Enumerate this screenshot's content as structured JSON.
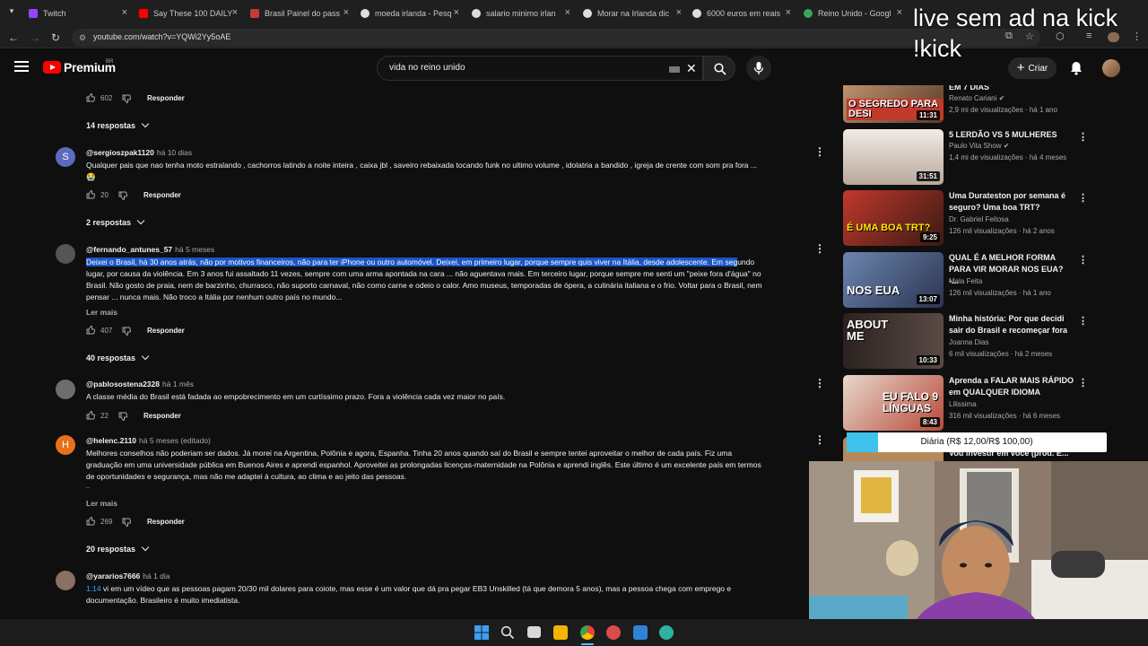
{
  "browser": {
    "tabs": [
      {
        "title": "Twitch",
        "color": "#9146ff"
      },
      {
        "title": "Say These 100 DAILY",
        "color": "#ff0000"
      },
      {
        "title": "Brasil Painel do pass",
        "color": "#c23b3b"
      },
      {
        "title": "moeda irlanda - Pesq",
        "color": "#dddddd"
      },
      {
        "title": "salario minimo irlan",
        "color": "#dddddd"
      },
      {
        "title": "Morar na Irlanda dic",
        "color": "#dddddd"
      },
      {
        "title": "6000 euros em reais",
        "color": "#dddddd"
      },
      {
        "title": "Reino Unido - Googl",
        "color": "#34a853"
      }
    ],
    "url": "youtube.com/watch?v=YQWi2Yy5oAE"
  },
  "overlay_text": [
    "live sem ad na kick",
    "!kick"
  ],
  "header": {
    "logo": "Premium",
    "region": "BR",
    "search_value": "vida no reino unido",
    "create_label": "Criar"
  },
  "comments": {
    "top": {
      "likes": "602",
      "reply": "Responder",
      "replies": "14 respostas"
    },
    "items": [
      {
        "handle": "@sergioszpak1120",
        "time": "há 10 dias",
        "avatar_letter": "S",
        "avatar_color": "#5c6bc0",
        "lines": [
          "Qualquer pais que nao tenha moto estralando , cachorros latindo a noite inteira , caixa jbl , saveiro rebaixada tocando funk no ultimo volume , idolatria a  bandido , igreja de crente com som pra fora ...",
          "😭"
        ],
        "likes": "20",
        "reply": "Responder",
        "replies": "2 respostas"
      },
      {
        "handle": "@fernando_antunes_57",
        "time": "há 5 meses",
        "avatar_letter": "",
        "avatar_color": "#555555",
        "line1_highlight": "Deixei o Brasil, há 30 anos atrás, não por motivos financeiros, não para ter iPhone ou outro automóvel. Deixei, em primeiro lugar, porque sempre quis viver na Itália, desde adolescente. Em seg",
        "line1_rest": "undo",
        "lines": [
          "lugar, por causa da violência. Em 3 anos fui assaltado 11 vezes, sempre com uma arma apontada na cara ... não aguentava mais. Em terceiro lugar, porque sempre me senti um \"peixe fora d'água\" no",
          "Brasil. Não gosto de praia, nem de barzinho, churrasco, não suporto carnaval, não como carne e odeio o calor. Amo museus, temporadas de ópera, a culinária italiana e o frio. Voltar para o Brasil, nem",
          "pensar ... nunca mais. Não troco a Itália por nenhum outro país no mundo..."
        ],
        "more": "Ler mais",
        "likes": "407",
        "reply": "Responder",
        "replies": "40 respostas"
      },
      {
        "handle": "@pablosostena2328",
        "time": "há 1 mês",
        "avatar_letter": "",
        "avatar_color": "#6d6d6d",
        "lines": [
          "A classe média do Brasil está fadada ao empobrecimento em um curtíssimo prazo. Fora a violência cada vez maior no país."
        ],
        "likes": "22",
        "reply": "Responder"
      },
      {
        "handle": "@helenc.2110",
        "time": "há 5 meses (editado)",
        "avatar_letter": "H",
        "avatar_color": "#e8711c",
        "lines": [
          "Melhores conselhos não poderiam ser dados. Já morei na Argentina, Polônia e agora, Espanha. Tinha 20 anos quando saí do Brasil e sempre tentei aproveitar o melhor de cada país. Fiz uma",
          "graduação em uma universidade pública em Buenos Aires e aprendi espanhol. Aproveitei as prolongadas licenças-maternidade na Polônia e aprendi inglês. Este último é um excelente país em termos",
          "de oportunidades e segurança, mas não me adaptei à cultura, ao clima e ao jeito das pessoas.",
          ".."
        ],
        "more": "Ler mais",
        "likes": "269",
        "reply": "Responder",
        "replies": "20 respostas"
      },
      {
        "handle": "@yararios7666",
        "time": "há 1 dia",
        "avatar_letter": "",
        "avatar_color": "#8a6f63",
        "timestamp_link": "1:14",
        "line1_rest": " vi em um vídeo que as pessoas pagam 20/30 mil dolares para coiote, mas esse é um valor que dá pra pegar EB3 Unskilled (tá que demora 5 anos), mas a pessoa chega com emprego e",
        "lines": [
          "documentação. Brasileiro é muito imediatista."
        ]
      }
    ]
  },
  "sidebar": {
    "videos": [
      {
        "title": "EM 7 DIAS",
        "channel": "Renato Cariani",
        "verified": true,
        "meta": "2,9 mi de visualizações · há 1 ano",
        "duration": "11:31",
        "caption": "O SEGREDO PARA DESI",
        "thumb_color": "#8a5a3c"
      },
      {
        "title": "5 LERDÃO VS 5 MULHERES",
        "channel": "Paulo Vita Show",
        "verified": true,
        "meta": "1,4 mi de visualizações · há 4 meses",
        "duration": "31:51",
        "caption": "",
        "thumb_color": "#d8d0c8"
      },
      {
        "title": "Uma Durateston por semana é seguro? Uma boa TRT?",
        "channel": "Dr. Gabriel Feitosa",
        "verified": false,
        "meta": "126 mil visualizações · há 2 anos",
        "duration": "9:25",
        "caption": "É UMA BOA TRT?",
        "thumb_color": "#9b3a2a"
      },
      {
        "title": "QUAL É A MELHOR FORMA PARA VIR MORAR NOS EUA? -...",
        "channel": "Mala Feita",
        "verified": false,
        "meta": "126 mil visualizações · há 1 ano",
        "duration": "13:07",
        "caption": "NOS EUA",
        "thumb_color": "#5b6f8f"
      },
      {
        "title": "Minha história: Por que decidi sair do Brasil e recomeçar fora",
        "channel": "Joanna Dias",
        "verified": false,
        "meta": "6 mil visualizações · há 2 meses",
        "duration": "10:33",
        "caption": "ABOUT ME",
        "thumb_color": "#3a2e2a"
      },
      {
        "title": "Aprenda a FALAR MAIS RÁPIDO em QUALQUER IDIOMA",
        "channel": "Lilissima",
        "verified": false,
        "meta": "316 mil visualizações · há 6 meses",
        "duration": "8:43",
        "caption": "EU FALO 9 LÍNGUAS",
        "thumb_color": "#c94a3a"
      }
    ],
    "partial_title": "Vou investir em você (prod. E..."
  },
  "donation": {
    "label": "Diária (R$ 12,00/R$ 100,00)",
    "progress": 0.12
  },
  "colors": {
    "accent": "#ff0000",
    "highlight": "#1a56c4",
    "link": "#3ea6ff",
    "donation": "#3fc3ee"
  }
}
